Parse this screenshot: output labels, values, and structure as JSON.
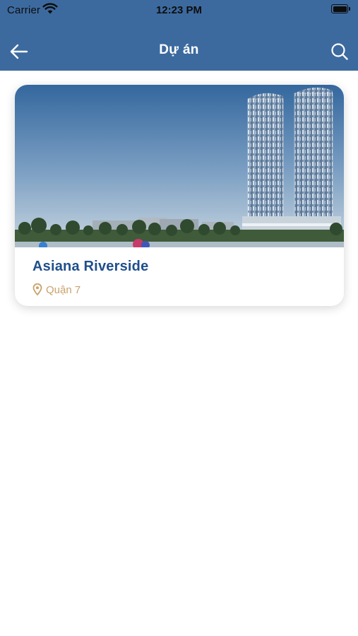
{
  "status_bar": {
    "carrier": "Carrier",
    "time": "12:23 PM"
  },
  "nav": {
    "title": "Dự án",
    "back_icon": "arrow-left-icon",
    "search_icon": "search-icon"
  },
  "projects": [
    {
      "name": "Asiana Riverside",
      "location": "Quận 7",
      "location_icon": "map-pin-icon"
    }
  ],
  "colors": {
    "header_bg": "#3c6a9f",
    "title_blue": "#1f4f8c",
    "location_gold": "#c9a26b"
  }
}
